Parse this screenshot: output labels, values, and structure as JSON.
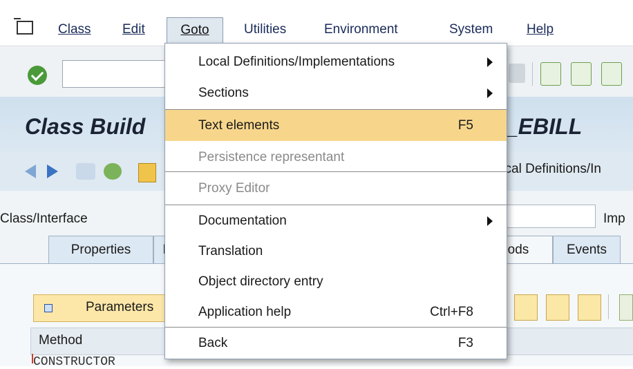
{
  "menubar": {
    "items": [
      {
        "label": "Class"
      },
      {
        "label": "Edit"
      },
      {
        "label": "Goto"
      },
      {
        "label": "Utilities"
      },
      {
        "label": "Environment"
      },
      {
        "label": "System"
      },
      {
        "label": "Help"
      }
    ]
  },
  "title": {
    "left": "Class Build",
    "right": "_EBILL"
  },
  "toolbar2": {
    "local_defs_text": "ocal Definitions/In"
  },
  "header": {
    "class_interface_label": "Class/Interface",
    "imp_label": "Imp"
  },
  "tabs": [
    {
      "label": "Properties"
    },
    {
      "label": "I"
    },
    {
      "label": "ods"
    },
    {
      "label": "Events"
    }
  ],
  "tab_area": {
    "parameters_label": "Parameters",
    "method_header": "Method",
    "constructor_text": "CONSTRUCTOR"
  },
  "goto_menu": {
    "items": [
      {
        "label": "Local Definitions/Implementations",
        "shortcut": "",
        "submenu": true,
        "disabled": false
      },
      {
        "label": "Sections",
        "shortcut": "",
        "submenu": true,
        "disabled": false
      },
      {
        "label": "Text elements",
        "shortcut": "F5",
        "submenu": false,
        "disabled": false,
        "highlighted": true
      },
      {
        "label": "Persistence representant",
        "shortcut": "",
        "submenu": false,
        "disabled": true
      },
      {
        "label": "Proxy Editor",
        "shortcut": "",
        "submenu": false,
        "disabled": true
      },
      {
        "label": "Documentation",
        "shortcut": "",
        "submenu": true,
        "disabled": false
      },
      {
        "label": "Translation",
        "shortcut": "",
        "submenu": false,
        "disabled": false
      },
      {
        "label": "Object directory entry",
        "shortcut": "",
        "submenu": false,
        "disabled": false
      },
      {
        "label": "Application help",
        "shortcut": "Ctrl+F8",
        "submenu": false,
        "disabled": false
      },
      {
        "label": "Back",
        "shortcut": "F3",
        "submenu": false,
        "disabled": false
      }
    ]
  },
  "colors": {
    "highlight": "#f7d68c",
    "ok_green": "#4a9a3a",
    "menu_text": "#1a2b5a"
  }
}
